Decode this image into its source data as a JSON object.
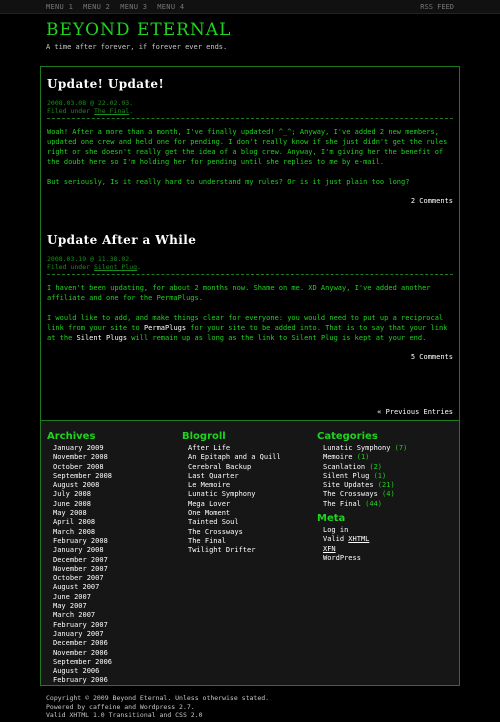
{
  "nav": {
    "menu": [
      "MENU 1",
      "MENU 2",
      "MENU 3",
      "MENU 4"
    ],
    "rss": "RSS FEED"
  },
  "site": {
    "title": "BEYOND ETERNAL",
    "tagline": "A time after forever, if forever ever ends."
  },
  "posts": [
    {
      "title": "Update! Update!",
      "date": "2008.03.08 @ 22.02.03.",
      "filed_prefix": "Filed under ",
      "category": "The Final",
      "p1": "Woah! After a more than a month, I've finally updated! ^_^; Anyway, I've added 2 new members, updated one crew and held one for pending. I don't really know if she just didn't get the rules right or she doesn't really get the idea of a blog crew. Anyway, I'm giving her the benefit of the doubt here so I'm holding her for pending until she replies to me by e-mail.",
      "p2": "But seriously, Is it really hard to understand my rules? Or is it just plain too long?",
      "comments": "2 Comments"
    },
    {
      "title": "Update After a While",
      "date": "2008.03.19 @ 11.38.02.",
      "filed_prefix": "Filed under ",
      "category": "Silent Plug",
      "p1": "I haven't been updating, for about 2 months now. Shame on me. XD Anyway, I've added another affiliate and one for the PermaPlugs.",
      "p2_a": "I would like to add, and make things clear for everyone: you would need to put up a reciprocal link from your site to ",
      "p2_link1": "PermaPlugs",
      "p2_b": " for your site to be added into. That is to say that your link at the ",
      "p2_link2": "Silent Plugs",
      "p2_c": " will remain up as long as the link to Silent Plug is kept at your end.",
      "comments": "5 Comments"
    }
  ],
  "prev_entries": "« Previous Entries",
  "archives": {
    "heading": "Archives",
    "items": [
      "January 2009",
      "November 2008",
      "October 2008",
      "September 2008",
      "August 2008",
      "July 2008",
      "June 2008",
      "May 2008",
      "April 2008",
      "March 2008",
      "February 2008",
      "January 2008",
      "December 2007",
      "November 2007",
      "October 2007",
      "August 2007",
      "June 2007",
      "May 2007",
      "March 2007",
      "February 2007",
      "January 2007",
      "December 2006",
      "November 2006",
      "September 2006",
      "August 2006",
      "February 2006"
    ]
  },
  "blogroll": {
    "heading": "Blogroll",
    "items": [
      "After Life",
      "An Epitaph and a Quill",
      "Cerebral Backup",
      "Last Quarter",
      "Le Memoire",
      "Lunatic Symphony",
      "Mega Lover",
      "One Moment",
      "Tainted Soul",
      "The Crossways",
      "The Final",
      "Twilight Drifter"
    ]
  },
  "categories": {
    "heading": "Categories",
    "items": [
      {
        "name": "Lunatic Symphony",
        "count": "(7)"
      },
      {
        "name": "Memoire",
        "count": "(1)"
      },
      {
        "name": "Scanlation",
        "count": "(2)"
      },
      {
        "name": "Silent Plug",
        "count": "(1)"
      },
      {
        "name": "Site Updates",
        "count": "(21)"
      },
      {
        "name": "The Crossways",
        "count": "(4)"
      },
      {
        "name": "The Final",
        "count": "(44)"
      }
    ]
  },
  "meta": {
    "heading": "Meta",
    "login": "Log in",
    "valid_prefix": "Valid ",
    "xhtml": "XHTML",
    "xfn": "XFN",
    "wordpress": "WordPress"
  },
  "footer": {
    "line1": "Copyright © 2009 Beyond Eternal. Unless otherwise stated.",
    "line2": "Powered by caffeine and Wordpress 2.7.",
    "line3": "Valid XHTML 1.0 Transitional and CSS 2.0"
  }
}
